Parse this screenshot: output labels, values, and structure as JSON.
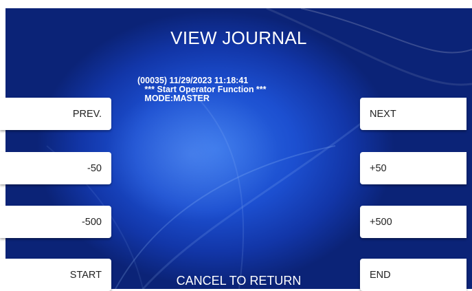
{
  "screen": {
    "title": "VIEW JOURNAL",
    "footer_prompt": "CANCEL TO RETURN"
  },
  "journal": {
    "lines": [
      "(00035) 11/29/2023 11:18:41",
      "   *** Start Operator Function ***",
      "   MODE:MASTER"
    ]
  },
  "buttons": {
    "left": [
      "PREV.",
      "-50",
      "-500",
      "START"
    ],
    "right": [
      "NEXT",
      "+50",
      "+500",
      "END"
    ]
  },
  "colors": {
    "background_dark": "#0b2377",
    "background_mid": "#1c4fd0",
    "background_light": "#2f6ee6",
    "button_bg": "#ffffff",
    "button_text": "#222222",
    "text": "#ffffff"
  }
}
